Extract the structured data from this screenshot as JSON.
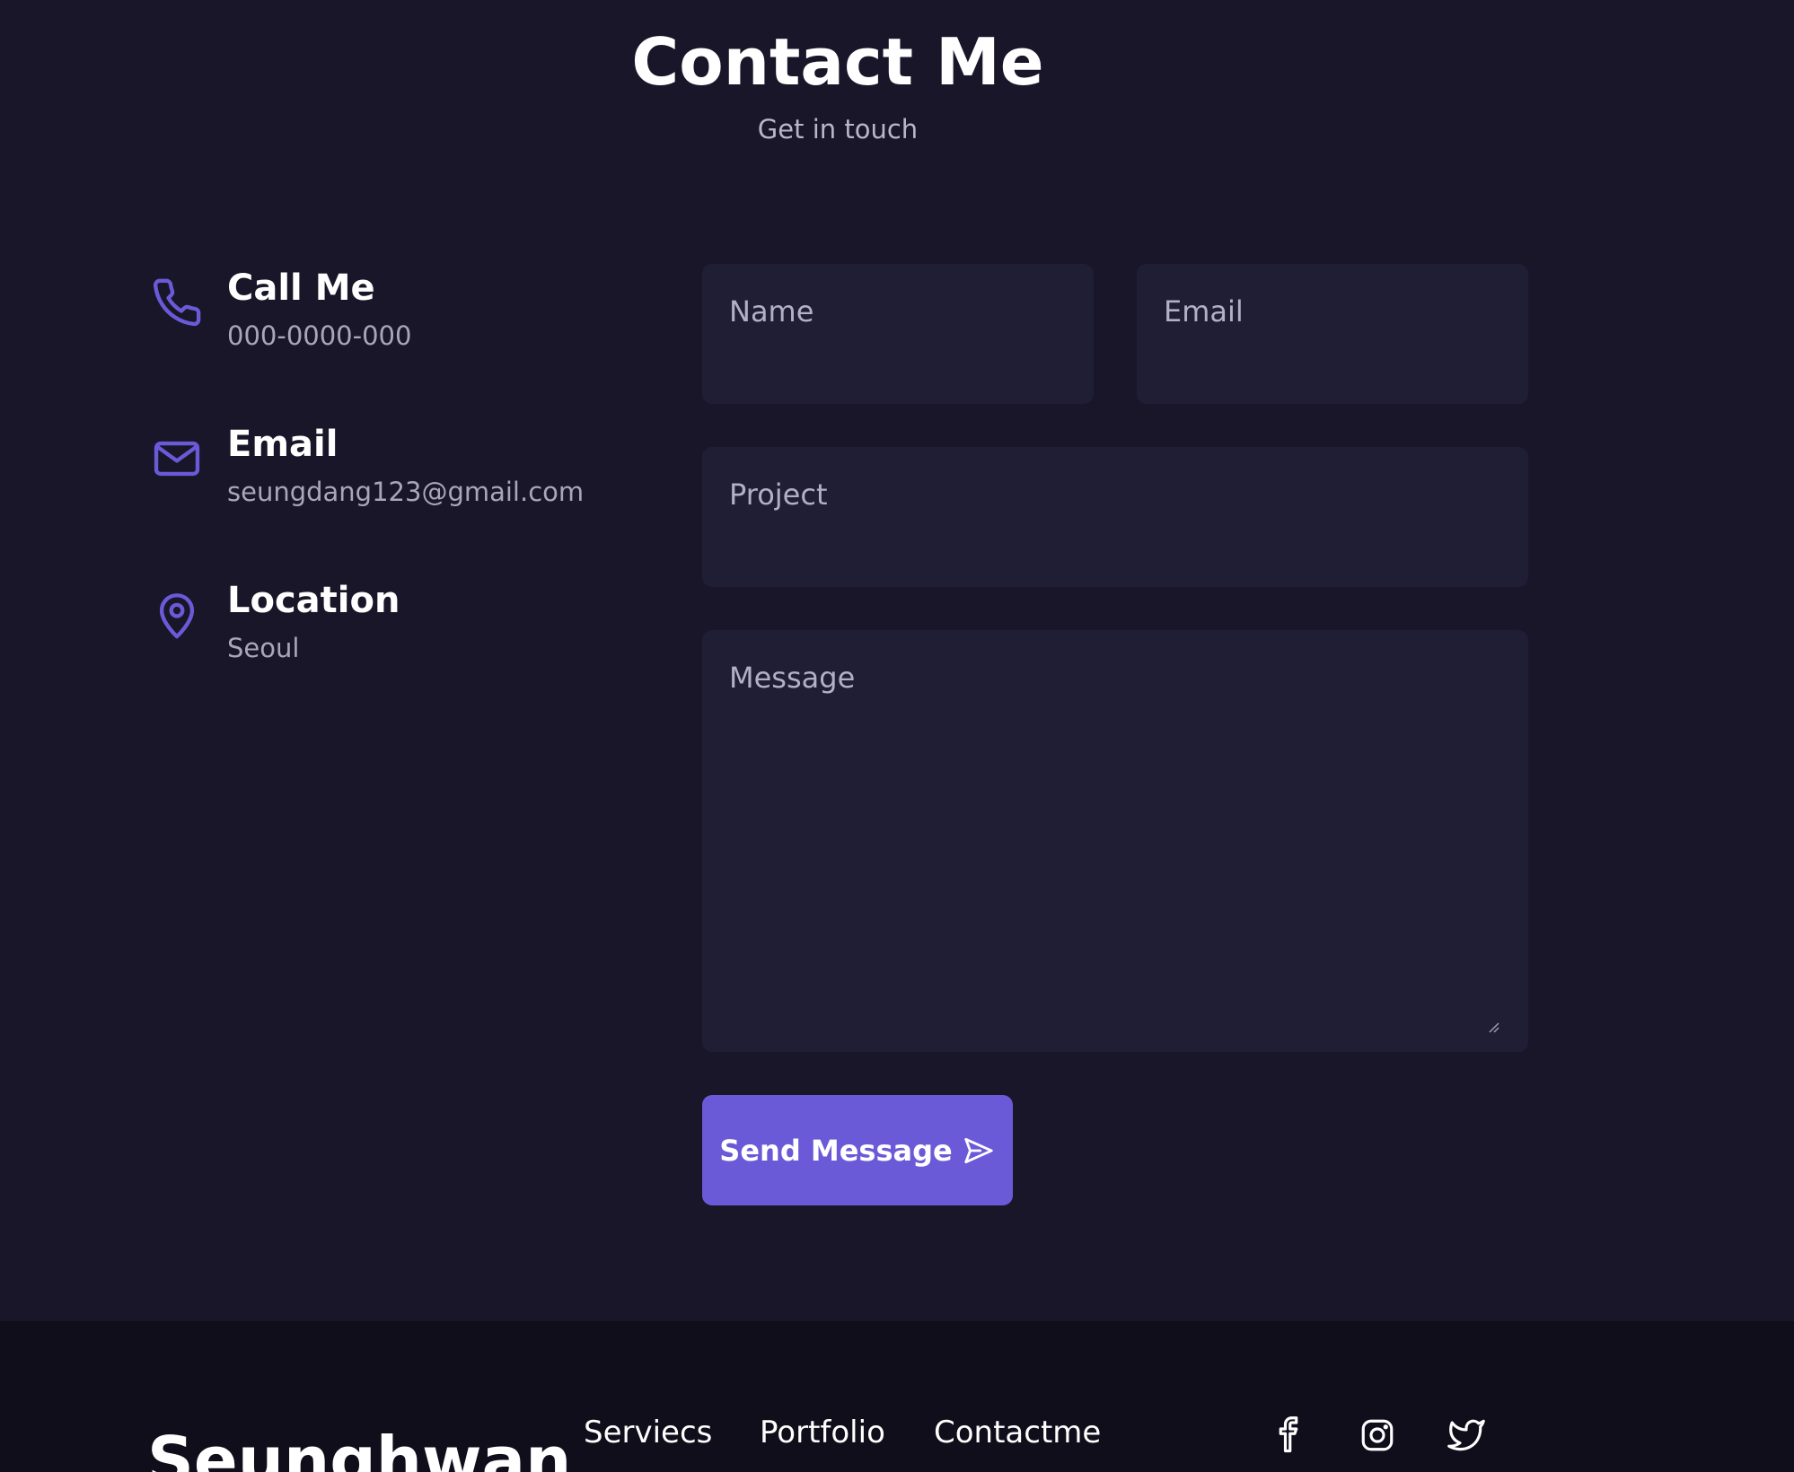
{
  "header": {
    "title": "Contact Me",
    "subtitle": "Get in touch"
  },
  "contact_info": [
    {
      "icon": "phone-icon",
      "title": "Call Me",
      "value": "000-0000-000"
    },
    {
      "icon": "mail-icon",
      "title": "Email",
      "value": "seungdang123@gmail.com"
    },
    {
      "icon": "location-pin-icon",
      "title": "Location",
      "value": "Seoul"
    }
  ],
  "form": {
    "name_placeholder": "Name",
    "email_placeholder": "Email",
    "project_placeholder": "Project",
    "message_placeholder": "Message",
    "submit_label": "Send Message",
    "submit_icon": "send-icon"
  },
  "footer": {
    "brand": "Seunghwan",
    "links": [
      "Serviecs",
      "Portfolio",
      "Contactme"
    ],
    "social": [
      "facebook-icon",
      "instagram-icon",
      "twitter-icon"
    ]
  },
  "colors": {
    "background": "#181628",
    "input_background": "#201e35",
    "accent": "#6a5ad8",
    "footer_background": "#0f0e1a",
    "muted_text": "#a9a6b9"
  }
}
